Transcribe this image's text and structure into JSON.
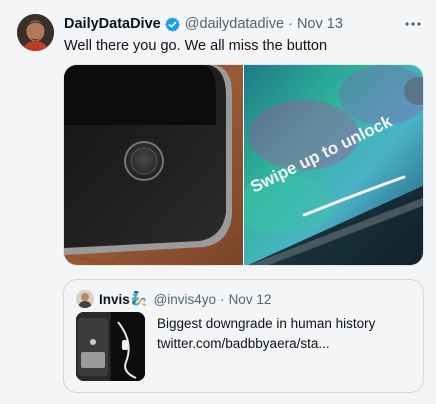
{
  "tweet": {
    "author_name": "DailyDataDive",
    "author_handle": "@dailydatadive",
    "separator": "·",
    "date": "Nov 13",
    "text": "Well there you go. We all miss the button",
    "media": {
      "right_overlay_text": "Swipe up to unlock"
    },
    "more_icon": "more-horizontal-icon",
    "verified_icon": "verified-badge-icon",
    "verified_color": "#1d9bf0"
  },
  "quoted": {
    "author_name": "Invis",
    "author_emoji": "🧞",
    "author_handle": "@invis4yo",
    "separator": "·",
    "date": "Nov 12",
    "text": "Biggest downgrade in human history",
    "link": "twitter.com/badbbyaera/sta..."
  },
  "colors": {
    "background": "#f4f5f6",
    "secondary_text": "#536471",
    "border": "#cfd9de"
  }
}
